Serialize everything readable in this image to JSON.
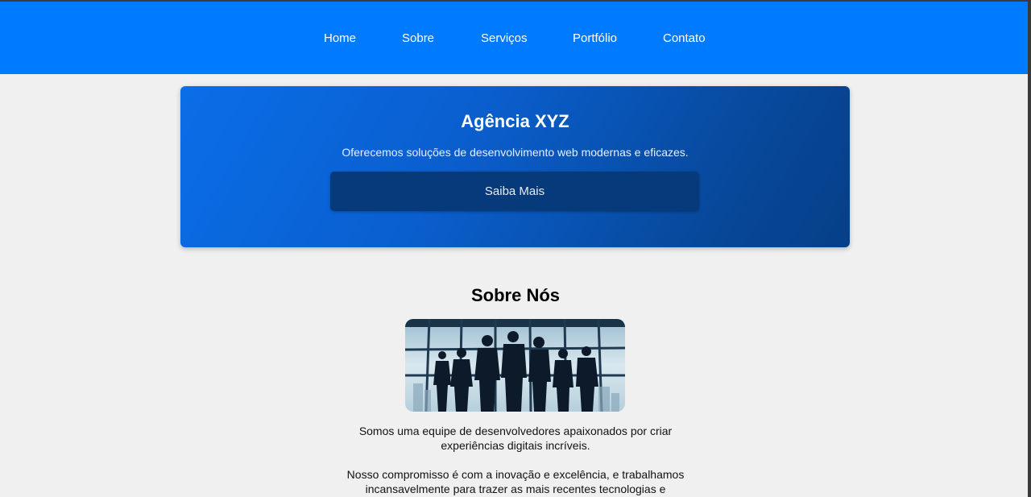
{
  "nav": {
    "items": [
      {
        "label": "Home"
      },
      {
        "label": "Sobre"
      },
      {
        "label": "Serviços"
      },
      {
        "label": "Portfólio"
      },
      {
        "label": "Contato"
      }
    ]
  },
  "hero": {
    "title": "Agência XYZ",
    "subtitle": "Oferecemos soluções de desenvolvimento web modernas e eficazes.",
    "button_label": "Saiba Mais"
  },
  "about": {
    "title": "Sobre Nós",
    "paragraph1": "Somos uma equipe de desenvolvedores apaixonados por criar experiências digitais incríveis.",
    "paragraph2": "Nosso compromisso é com a inovação e excelência, e trabalhamos incansavelmente para trazer as mais recentes tecnologias e"
  },
  "colors": {
    "nav_bg": "#007bff",
    "hero_bg_start": "#0a6ee8",
    "hero_bg_end": "#063f88",
    "hero_button": "#063a7a",
    "page_bg": "#f0f0f0"
  }
}
